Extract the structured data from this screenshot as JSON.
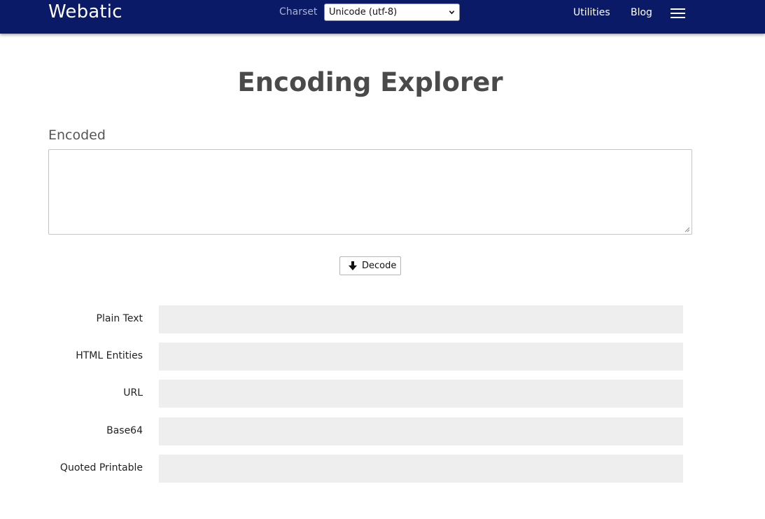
{
  "header": {
    "brand": "Webatic",
    "charset_label": "Charset",
    "charset_selected": "Unicode (utf-8)",
    "links": [
      "Utilities",
      "Blog"
    ],
    "bg_color": "#0b1a66"
  },
  "main": {
    "title": "Encoding Explorer",
    "encoded_label": "Encoded",
    "encoded_value": "",
    "decode_button": "Decode",
    "rows": [
      {
        "label": "Plain Text",
        "value": ""
      },
      {
        "label": "HTML Entities",
        "value": ""
      },
      {
        "label": "URL",
        "value": ""
      },
      {
        "label": "Base64",
        "value": ""
      },
      {
        "label": "Quoted Printable",
        "value": ""
      }
    ]
  },
  "icons": {
    "menu": "hamburger-menu-icon",
    "decode": "arrow-down-icon",
    "select": "chevron-down-icon"
  }
}
